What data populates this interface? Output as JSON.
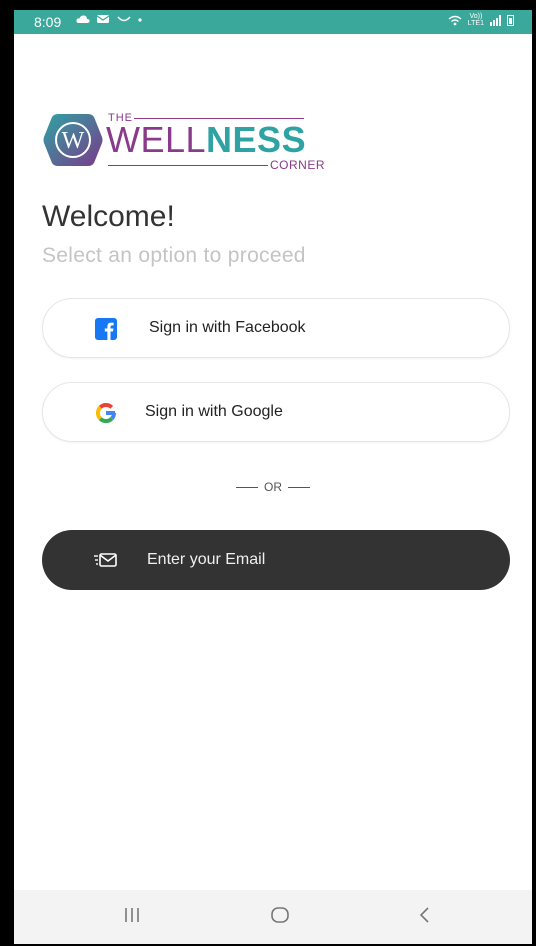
{
  "status_bar": {
    "time": "8:09",
    "left_icons": [
      "cloud-icon",
      "message-icon",
      "missed-call-icon",
      "dot-icon"
    ],
    "right_icons": [
      "wifi-icon",
      "volte-icon",
      "signal-icon",
      "battery-icon"
    ],
    "volte_text": "Vo))\nLTE1"
  },
  "logo": {
    "mark_letter": "W",
    "the": "THE",
    "wellness_a": "WELL",
    "wellness_b": "NESS",
    "corner": "CORNER"
  },
  "welcome_title": "Welcome!",
  "subtitle": "Select an option to proceed",
  "buttons": {
    "facebook": "Sign in with Facebook",
    "google": "Sign in with Google",
    "or": "OR",
    "email": "Enter your Email"
  },
  "colors": {
    "status_bar": "#3aa89a",
    "brand_purple": "#8a3a8a",
    "brand_teal": "#2fa3a3",
    "facebook_blue": "#1877f2",
    "email_button": "#333333"
  },
  "nav_bar": {
    "icons": [
      "recent-apps-icon",
      "home-icon",
      "back-icon"
    ]
  }
}
